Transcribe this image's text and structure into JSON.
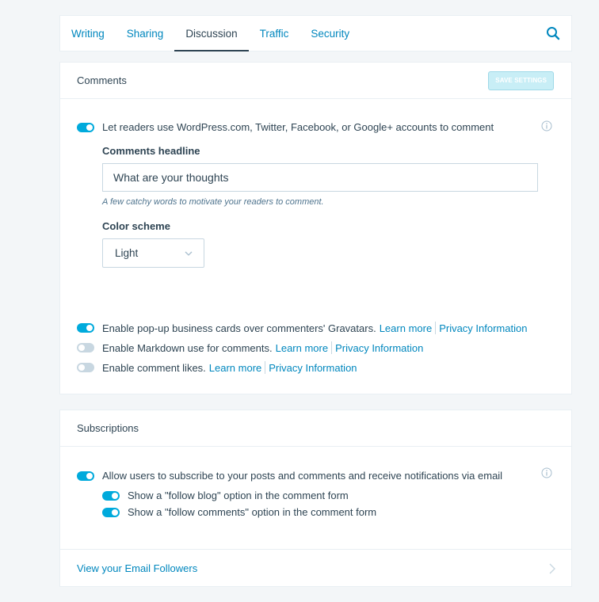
{
  "tabs": [
    {
      "label": "Writing"
    },
    {
      "label": "Sharing"
    },
    {
      "label": "Discussion"
    },
    {
      "label": "Traffic"
    },
    {
      "label": "Security"
    }
  ],
  "active_tab": "Discussion",
  "comments": {
    "title": "Comments",
    "save_label": "SAVE SETTINGS",
    "social_login": {
      "label": "Let readers use WordPress.com, Twitter, Facebook, or Google+ accounts to comment",
      "enabled": true
    },
    "headline_label": "Comments headline",
    "headline_value": "What are your thoughts",
    "headline_hint": "A few catchy words to motivate your readers to comment.",
    "color_scheme_label": "Color scheme",
    "color_scheme_value": "Light",
    "options": [
      {
        "label": "Enable pop-up business cards over commenters' Gravatars.",
        "learn_more": "Learn more",
        "privacy": "Privacy Information",
        "enabled": true
      },
      {
        "label": "Enable Markdown use for comments.",
        "learn_more": "Learn more",
        "privacy": "Privacy Information",
        "enabled": false
      },
      {
        "label": "Enable comment likes.",
        "learn_more": "Learn more",
        "privacy": "Privacy Information",
        "enabled": false
      }
    ]
  },
  "subscriptions": {
    "title": "Subscriptions",
    "main": {
      "label": "Allow users to subscribe to your posts and comments and receive notifications via email",
      "enabled": true
    },
    "follow_blog": {
      "label": "Show a \"follow blog\" option in the comment form",
      "enabled": true
    },
    "follow_comments": {
      "label": "Show a \"follow comments\" option in the comment form",
      "enabled": true
    },
    "followers_link": "View your Email Followers"
  },
  "icons": {
    "search": "search-icon",
    "info": "info-icon",
    "chevron": "chevron-right-icon",
    "select": "chevron-down-icon"
  },
  "colors": {
    "accent": "#0087be",
    "toggle_on": "#00aadc",
    "toggle_off": "#c8d7e1",
    "text": "#2e4453"
  }
}
